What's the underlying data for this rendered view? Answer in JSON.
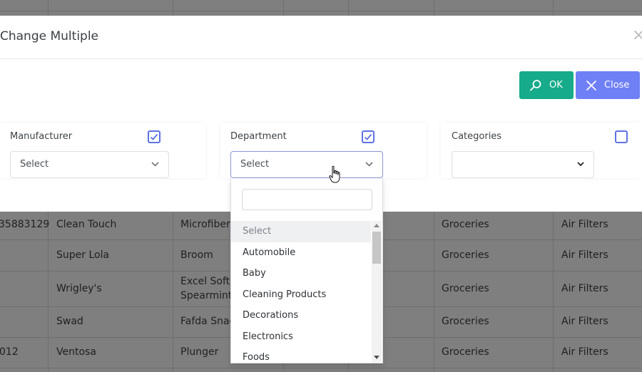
{
  "modal": {
    "title": "Change Multiple",
    "close_symbol": "×",
    "ok_label": "OK",
    "close_label": "Close"
  },
  "filters": {
    "manufacturer": {
      "label": "Manufacturer",
      "checked": true,
      "value": "Select"
    },
    "department": {
      "label": "Department",
      "checked": true,
      "value": "Select"
    },
    "categories": {
      "label": "Categories",
      "checked": false,
      "value": ""
    }
  },
  "department_dropdown": {
    "search_value": "",
    "options": [
      "Select",
      "Automobile",
      "Baby",
      "Cleaning Products",
      "Decorations",
      "Electronics",
      "Foods"
    ]
  },
  "background_table": {
    "rows": [
      {
        "code": "35883129",
        "manufacturer": "Clean Touch",
        "product": "Microfiber",
        "department": "Groceries",
        "category": "Air Filters"
      },
      {
        "code": "",
        "manufacturer": "Super Lola",
        "product": "Broom",
        "department": "Groceries",
        "category": "Air Filters"
      },
      {
        "code": "",
        "manufacturer": "Wrigley's",
        "product": "Excel Soft C",
        "product_line2": "Spearmint",
        "department": "Groceries",
        "category": "Air Filters"
      },
      {
        "code": "",
        "manufacturer": "Swad",
        "product": "Fafda Snac",
        "department": "Groceries",
        "category": "Air Filters"
      },
      {
        "code": "012",
        "manufacturer": "Ventosa",
        "product": "Plunger",
        "department": "Groceries",
        "category": "Air Filters"
      }
    ]
  },
  "colors": {
    "ok_button": "#16ab8a",
    "close_button": "#6f7ff5",
    "checkbox": "#5e72e4"
  }
}
